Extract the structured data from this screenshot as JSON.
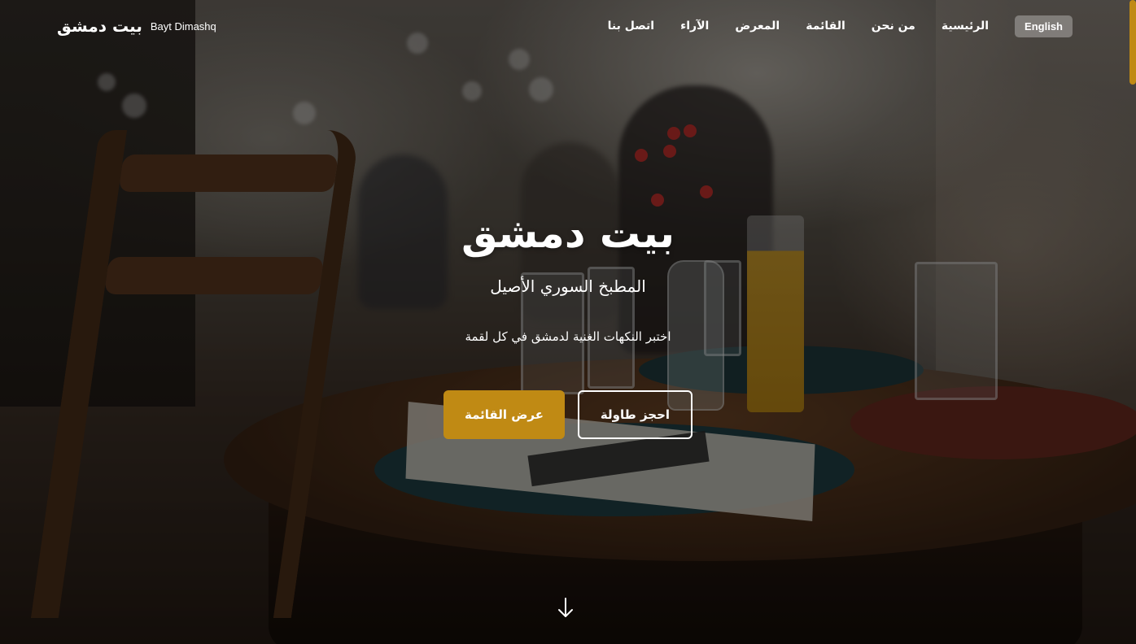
{
  "brand": {
    "name_ar": "بيت دمشق",
    "name_en": "Bayt Dimashq"
  },
  "nav": {
    "language_button": "English",
    "links": [
      {
        "label": "الرئيسية"
      },
      {
        "label": "من نحن"
      },
      {
        "label": "القائمة"
      },
      {
        "label": "المعرض"
      },
      {
        "label": "الآراء"
      },
      {
        "label": "اتصل بنا"
      }
    ]
  },
  "hero": {
    "title": "بيت دمشق",
    "subtitle": "المطبخ السوري الأصيل",
    "tagline": "اختبر النكهات الغنية لدمشق في كل لقمة",
    "primary_button": "عرض القائمة",
    "secondary_button": "احجز طاولة",
    "scroll_icon": "arrow-down-icon"
  },
  "colors": {
    "accent": "#c08a14",
    "text": "#ffffff"
  }
}
